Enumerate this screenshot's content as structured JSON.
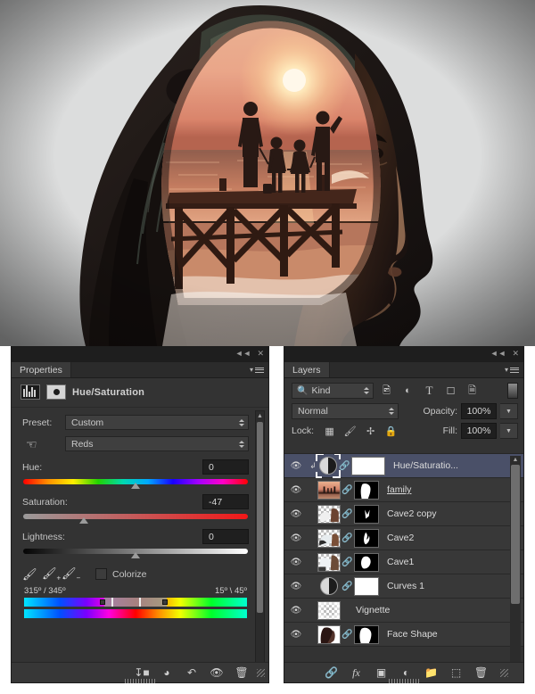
{
  "properties_panel": {
    "tab_label": "Properties",
    "collapse_icon": "double-chevron-left-icon",
    "close_icon": "close-icon",
    "menu_icon": "panel-menu-icon",
    "adjustment_title": "Hue/Saturation",
    "preset": {
      "label": "Preset:",
      "value": "Custom"
    },
    "channel": {
      "value": "Reds",
      "hand_icon": "on-image-adjust-hand-icon"
    },
    "sliders": [
      {
        "name": "Hue:",
        "value": "0",
        "knob_pct": 50
      },
      {
        "name": "Saturation:",
        "value": "-47",
        "knob_pct": 27
      },
      {
        "name": "Lightness:",
        "value": "0",
        "knob_pct": 50
      }
    ],
    "eyedroppers": [
      "eyedropper-icon",
      "eyedropper-add-icon",
      "eyedropper-subtract-icon"
    ],
    "colorize": {
      "label": "Colorize",
      "checked": false
    },
    "range_left": "315º / 345º",
    "range_right": "15º \\ 45º",
    "footer_buttons": [
      "clip-to-layer-icon",
      "toggle-previous-state-icon",
      "reset-icon",
      "toggle-visibility-icon",
      "delete-icon"
    ]
  },
  "layers_panel": {
    "tab_label": "Layers",
    "collapse_icon": "double-chevron-left-icon",
    "close_icon": "close-icon",
    "menu_icon": "panel-menu-icon",
    "filter": {
      "kind_label": "Kind",
      "search_icon": "search-icon",
      "type_filters": [
        "pixel-layer-filter-icon",
        "adjustment-layer-filter-icon",
        "type-layer-filter-icon",
        "shape-layer-filter-icon",
        "smart-object-filter-icon"
      ],
      "toggle_icon": "filter-enable-switch"
    },
    "blend_mode": "Normal",
    "opacity": {
      "label": "Opacity:",
      "value": "100%"
    },
    "fill": {
      "label": "Fill:",
      "value": "100%"
    },
    "lock": {
      "label": "Lock:",
      "icons": [
        "lock-transparent-pixels-icon",
        "lock-image-pixels-icon",
        "lock-position-icon",
        "lock-all-icon"
      ]
    },
    "layers": [
      {
        "name": "Hue/Saturatio...",
        "type": "adjustment",
        "visible": true,
        "selected": true,
        "clipped": true,
        "linked": true,
        "mask": "white",
        "editing": false
      },
      {
        "name": "family",
        "type": "pixel",
        "visible": true,
        "selected": false,
        "clipped": false,
        "linked": true,
        "mask": "silhouette",
        "editing": true
      },
      {
        "name": "Cave2 copy",
        "type": "pixel",
        "visible": true,
        "selected": false,
        "clipped": false,
        "linked": true,
        "mask": "shape-small",
        "editing": false
      },
      {
        "name": "Cave2",
        "type": "pixel",
        "visible": true,
        "selected": false,
        "clipped": false,
        "linked": true,
        "mask": "shape-flame",
        "editing": false
      },
      {
        "name": "Cave1",
        "type": "pixel",
        "visible": true,
        "selected": false,
        "clipped": false,
        "linked": true,
        "mask": "shape-blob",
        "editing": false
      },
      {
        "name": "Curves 1",
        "type": "adjustment",
        "visible": true,
        "selected": false,
        "clipped": false,
        "linked": true,
        "mask": "white",
        "editing": false
      },
      {
        "name": "Vignette",
        "type": "pixel",
        "visible": true,
        "selected": false,
        "clipped": false,
        "linked": false,
        "mask": "none",
        "editing": false
      },
      {
        "name": "Face Shape",
        "type": "pixel",
        "visible": true,
        "selected": false,
        "clipped": false,
        "linked": true,
        "mask": "head",
        "editing": false
      }
    ],
    "footer_buttons": [
      "link-layers-icon",
      "layer-style-fx-icon",
      "add-layer-mask-icon",
      "new-adjustment-layer-icon",
      "new-group-icon",
      "new-layer-icon",
      "delete-layer-icon"
    ]
  },
  "canvas": {
    "description": "Double exposure portrait: silhouette of a woman's head in profile filled with a sunset beach scene of a family of four standing on a wooden pier",
    "sky_top_color": "#e8a98f",
    "sky_horizon_color": "#d98f76",
    "sun_color": "#fff3cf",
    "silhouette_color": "#241a17",
    "background_color": "#d9dadb"
  }
}
